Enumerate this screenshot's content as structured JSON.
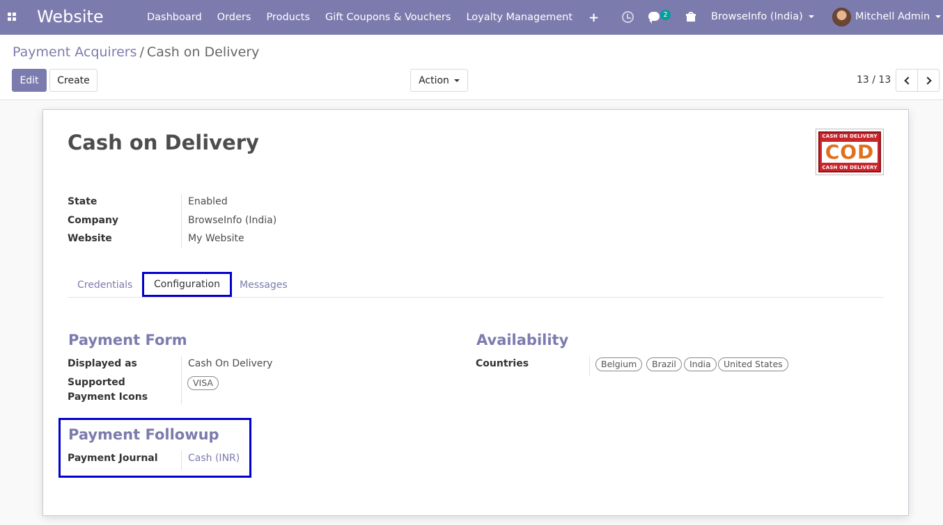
{
  "navbar": {
    "app_title": "Website",
    "menu": [
      "Dashboard",
      "Orders",
      "Products",
      "Gift Coupons & Vouchers",
      "Loyalty Management"
    ],
    "plus_label": "+",
    "messages_count": "2",
    "company": "BrowseInfo (India)",
    "user": "Mitchell Admin"
  },
  "breadcrumb": {
    "parent": "Payment Acquirers",
    "separator": "/",
    "current": "Cash on Delivery"
  },
  "toolbar": {
    "edit_label": "Edit",
    "create_label": "Create",
    "action_label": "Action",
    "pager": "13 / 13"
  },
  "record": {
    "title": "Cash on Delivery",
    "logo": {
      "top_text": "CASH ON DELIVERY",
      "main_text": "COD",
      "bottom_text": "CASH ON DELIVERY"
    },
    "fields": [
      {
        "label": "State",
        "value": "Enabled"
      },
      {
        "label": "Company",
        "value": "BrowseInfo (India)"
      },
      {
        "label": "Website",
        "value": "My Website"
      }
    ]
  },
  "tabs": [
    "Credentials",
    "Configuration",
    "Messages"
  ],
  "active_tab": "Configuration",
  "payment_form": {
    "title": "Payment Form",
    "displayed_as_label": "Displayed as",
    "displayed_as_value": "Cash On Delivery",
    "icons_label_line1": "Supported",
    "icons_label_line2": "Payment Icons",
    "icons": [
      "VISA"
    ]
  },
  "availability": {
    "title": "Availability",
    "countries_label": "Countries",
    "countries": [
      "Belgium",
      "Brazil",
      "India",
      "United States"
    ]
  },
  "payment_followup": {
    "title": "Payment Followup",
    "journal_label": "Payment Journal",
    "journal_value": "Cash (INR)"
  },
  "colors": {
    "brand": "#7c7bad",
    "highlight": "#0000cc",
    "badge": "#00a09d"
  }
}
